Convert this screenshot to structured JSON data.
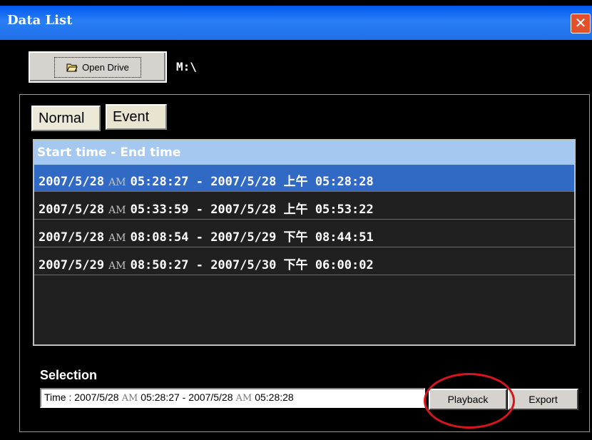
{
  "window": {
    "title": "Data List",
    "close_glyph": "✕"
  },
  "toolbar": {
    "open_drive_label": "Open Drive",
    "drive_path": "M:\\"
  },
  "tabs": [
    {
      "label": "Normal",
      "active": true
    },
    {
      "label": "Event",
      "active": false
    }
  ],
  "list": {
    "header": "Start time - End time",
    "rows": [
      {
        "start_date": "2007/5/28",
        "start_ampm": "AM",
        "start_time": "05:28:27",
        "end_date": "2007/5/28",
        "end_ampm": "上午",
        "end_time": "05:28:28",
        "selected": true
      },
      {
        "start_date": "2007/5/28",
        "start_ampm": "AM",
        "start_time": "05:33:59",
        "end_date": "2007/5/28",
        "end_ampm": "上午",
        "end_time": "05:53:22",
        "selected": false
      },
      {
        "start_date": "2007/5/28",
        "start_ampm": "AM",
        "start_time": "08:08:54",
        "end_date": "2007/5/29",
        "end_ampm": "下午",
        "end_time": "08:44:51",
        "selected": false
      },
      {
        "start_date": "2007/5/29",
        "start_ampm": "AM",
        "start_time": "08:50:27",
        "end_date": "2007/5/30",
        "end_ampm": "下午",
        "end_time": "06:00:02",
        "selected": false
      }
    ]
  },
  "selection": {
    "label": "Selection",
    "prefix": "Time : ",
    "start_date": "2007/5/28",
    "start_ampm": "AM",
    "start_time": "05:28:27",
    "separator": " - ",
    "end_date": "2007/5/28",
    "end_ampm": "AM",
    "end_time": "05:28:28"
  },
  "buttons": {
    "playback": "Playback",
    "export": "Export"
  },
  "colors": {
    "title_bar": "#0058ee",
    "selected_row": "#316ac5",
    "header_bg": "#a5c8f0",
    "highlight_ring": "#d8141c"
  },
  "icons": {
    "open_drive": "folder-open-icon",
    "close": "close-icon"
  }
}
